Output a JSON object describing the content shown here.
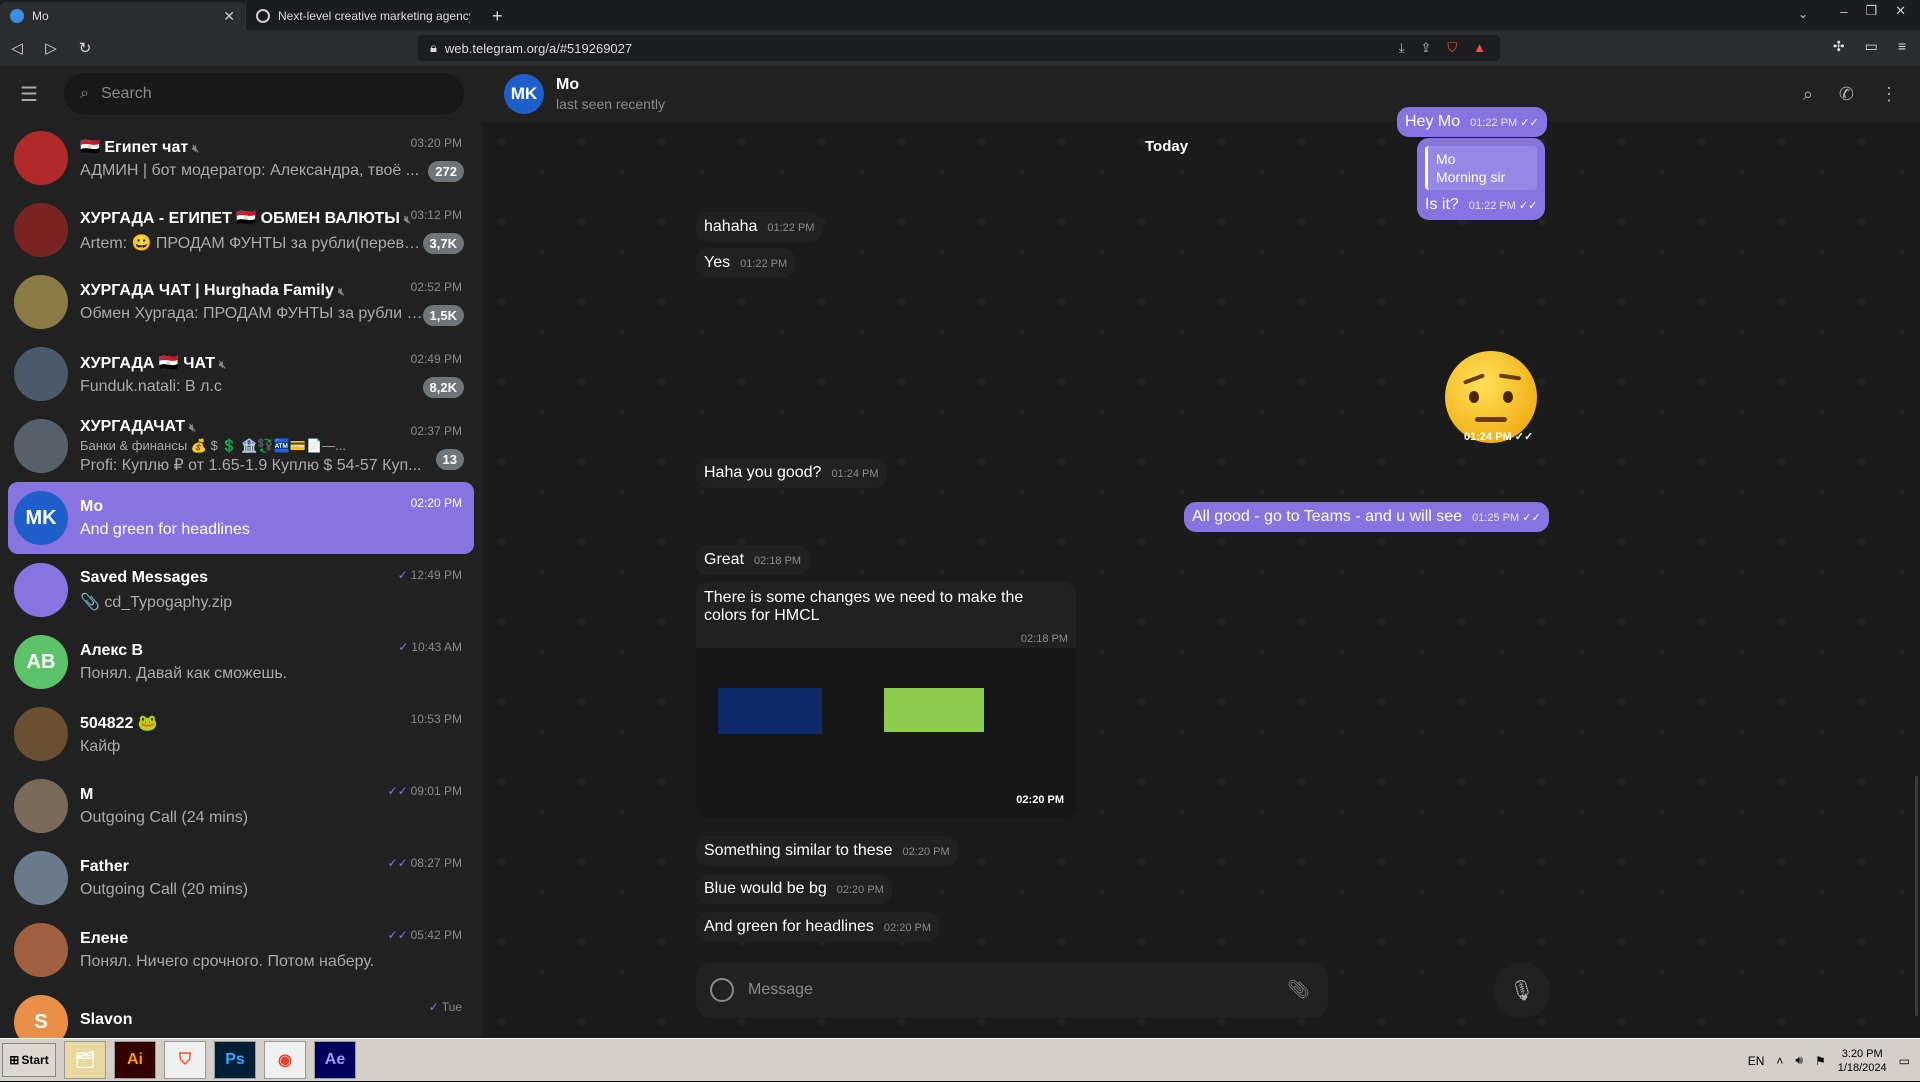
{
  "browser": {
    "tabs": [
      {
        "title": "Mo",
        "active": true
      },
      {
        "title": "Next-level creative marketing agency — C",
        "active": false
      }
    ],
    "url": "web.telegram.org/a/#519269027"
  },
  "sidebar": {
    "search_placeholder": "Search",
    "chats": [
      {
        "name": "🇪🇬 Египет чат",
        "muted": true,
        "time": "03:20 PM",
        "preview": "АДМИН | бот модератор: Александра, твоё ...",
        "badge": "272",
        "avatar_color": "#b02a2a"
      },
      {
        "name": "ХУРГАДА - ЕГИПЕТ 🇪🇬 ОБМЕН ВАЛЮТЫ",
        "muted": true,
        "time": "03:12 PM",
        "preview": "Artem: 😀 ПРОДАМ ФУНТЫ за рубли(перево...",
        "badge": "3,7K",
        "avatar_color": "#7a2323"
      },
      {
        "name": "ХУРГАДА ЧАТ | Hurghada Family",
        "muted": true,
        "time": "02:52 PM",
        "preview": "Обмен Хургада: ПРОДАМ ФУНТЫ за рубли (...",
        "badge": "1,5K",
        "avatar_color": "#8a7a44"
      },
      {
        "name": "ХУРГАДА 🇪🇬 ЧАТ",
        "muted": true,
        "time": "02:49 PM",
        "preview": "Funduk.natali: В л.с",
        "badge": "8,2K",
        "avatar_color": "#4a5a6a"
      },
      {
        "name": "ХУРГАДАЧАТ",
        "muted": true,
        "time": "02:37 PM",
        "preview_line1": "Банки & финансы 💰 $ 💲 🏦💱🏧💳📄—...",
        "preview": "Profi: Куплю ₽ от 1.65-1.9 Куплю $ 54-57 Куп...",
        "badge": "13",
        "avatar_color": "#55606a"
      },
      {
        "name": "Mo",
        "muted": false,
        "time": "02:20 PM",
        "preview": "And green for headlines",
        "badge": "",
        "avatar_color": "#1f5fc9",
        "avatar_text": "MK"
      },
      {
        "name": "Saved Messages",
        "muted": false,
        "time": "12:49 PM",
        "preview": "📎 cd_Typogaphy.zip",
        "badge": "",
        "avatar_color": "#8774e1",
        "check": "✓"
      },
      {
        "name": "Алекс B",
        "muted": false,
        "time": "10:43 AM",
        "preview": "Понял. Давай как сможешь.",
        "badge": "",
        "avatar_color": "#5cc36b",
        "avatar_text": "AB",
        "check": "✓"
      },
      {
        "name": "504822 🐸",
        "muted": false,
        "time": "10:53 PM",
        "preview": "Кайф",
        "badge": "",
        "avatar_color": "#6a5030"
      },
      {
        "name": "M",
        "muted": false,
        "time": "09:01 PM",
        "preview": "Outgoing Call (24 mins)",
        "badge": "",
        "avatar_color": "#7a6a5a",
        "check": "✓✓"
      },
      {
        "name": "Father",
        "muted": false,
        "time": "08:27 PM",
        "preview": "Outgoing Call (20 mins)",
        "badge": "",
        "avatar_color": "#6a7a8a",
        "check": "✓✓"
      },
      {
        "name": "Елене",
        "muted": false,
        "time": "05:42 PM",
        "preview": "Понял. Ничего срочного. Потом наберу.",
        "badge": "",
        "avatar_color": "#a06040",
        "check": "✓✓"
      },
      {
        "name": "Slavon",
        "muted": false,
        "time": "Tue",
        "preview": "",
        "badge": "",
        "avatar_color": "#e8904a",
        "avatar_text": "S",
        "check": "✓"
      }
    ]
  },
  "chat": {
    "name": "Mo",
    "status": "last seen recently",
    "avatar_text": "MK",
    "date_label": "Today",
    "messages": {
      "m1": {
        "text": "Hey Mo",
        "time": "01:22 PM"
      },
      "m2_reply_name": "Mo",
      "m2_reply_text": "Morning sir",
      "m2": {
        "text": "Is it?",
        "time": "01:22 PM"
      },
      "m3": {
        "text": "hahaha",
        "time": "01:22 PM"
      },
      "m4": {
        "text": "Yes",
        "time": "01:22 PM"
      },
      "sticker_time": "01:24 PM",
      "m5": {
        "text": "Haha you good?",
        "time": "01:24 PM"
      },
      "m6": {
        "text": "All good - go to Teams - and u will see",
        "time": "01:25 PM"
      },
      "m7": {
        "text": "Great",
        "time": "02:18 PM"
      },
      "m8": {
        "text": "There is some changes we need to make the colors for HMCL",
        "time": "02:18 PM"
      },
      "photo_time": "02:20 PM",
      "m9": {
        "text": "Something similar to these",
        "time": "02:20 PM"
      },
      "m10": {
        "text": "Blue would be bg",
        "time": "02:20 PM"
      },
      "m11": {
        "text": "And green for headlines",
        "time": "02:20 PM"
      }
    },
    "composer_placeholder": "Message"
  },
  "taskbar": {
    "start": "Start",
    "apps": [
      "Ai",
      "Ps",
      "Ae"
    ],
    "lang": "EN",
    "clock_time": "3:20 PM",
    "clock_date": "1/18/2024"
  },
  "colors": {
    "accent": "#8774e1",
    "swatch_blue": "#0d2a6b",
    "swatch_green": "#8dcc4f"
  }
}
